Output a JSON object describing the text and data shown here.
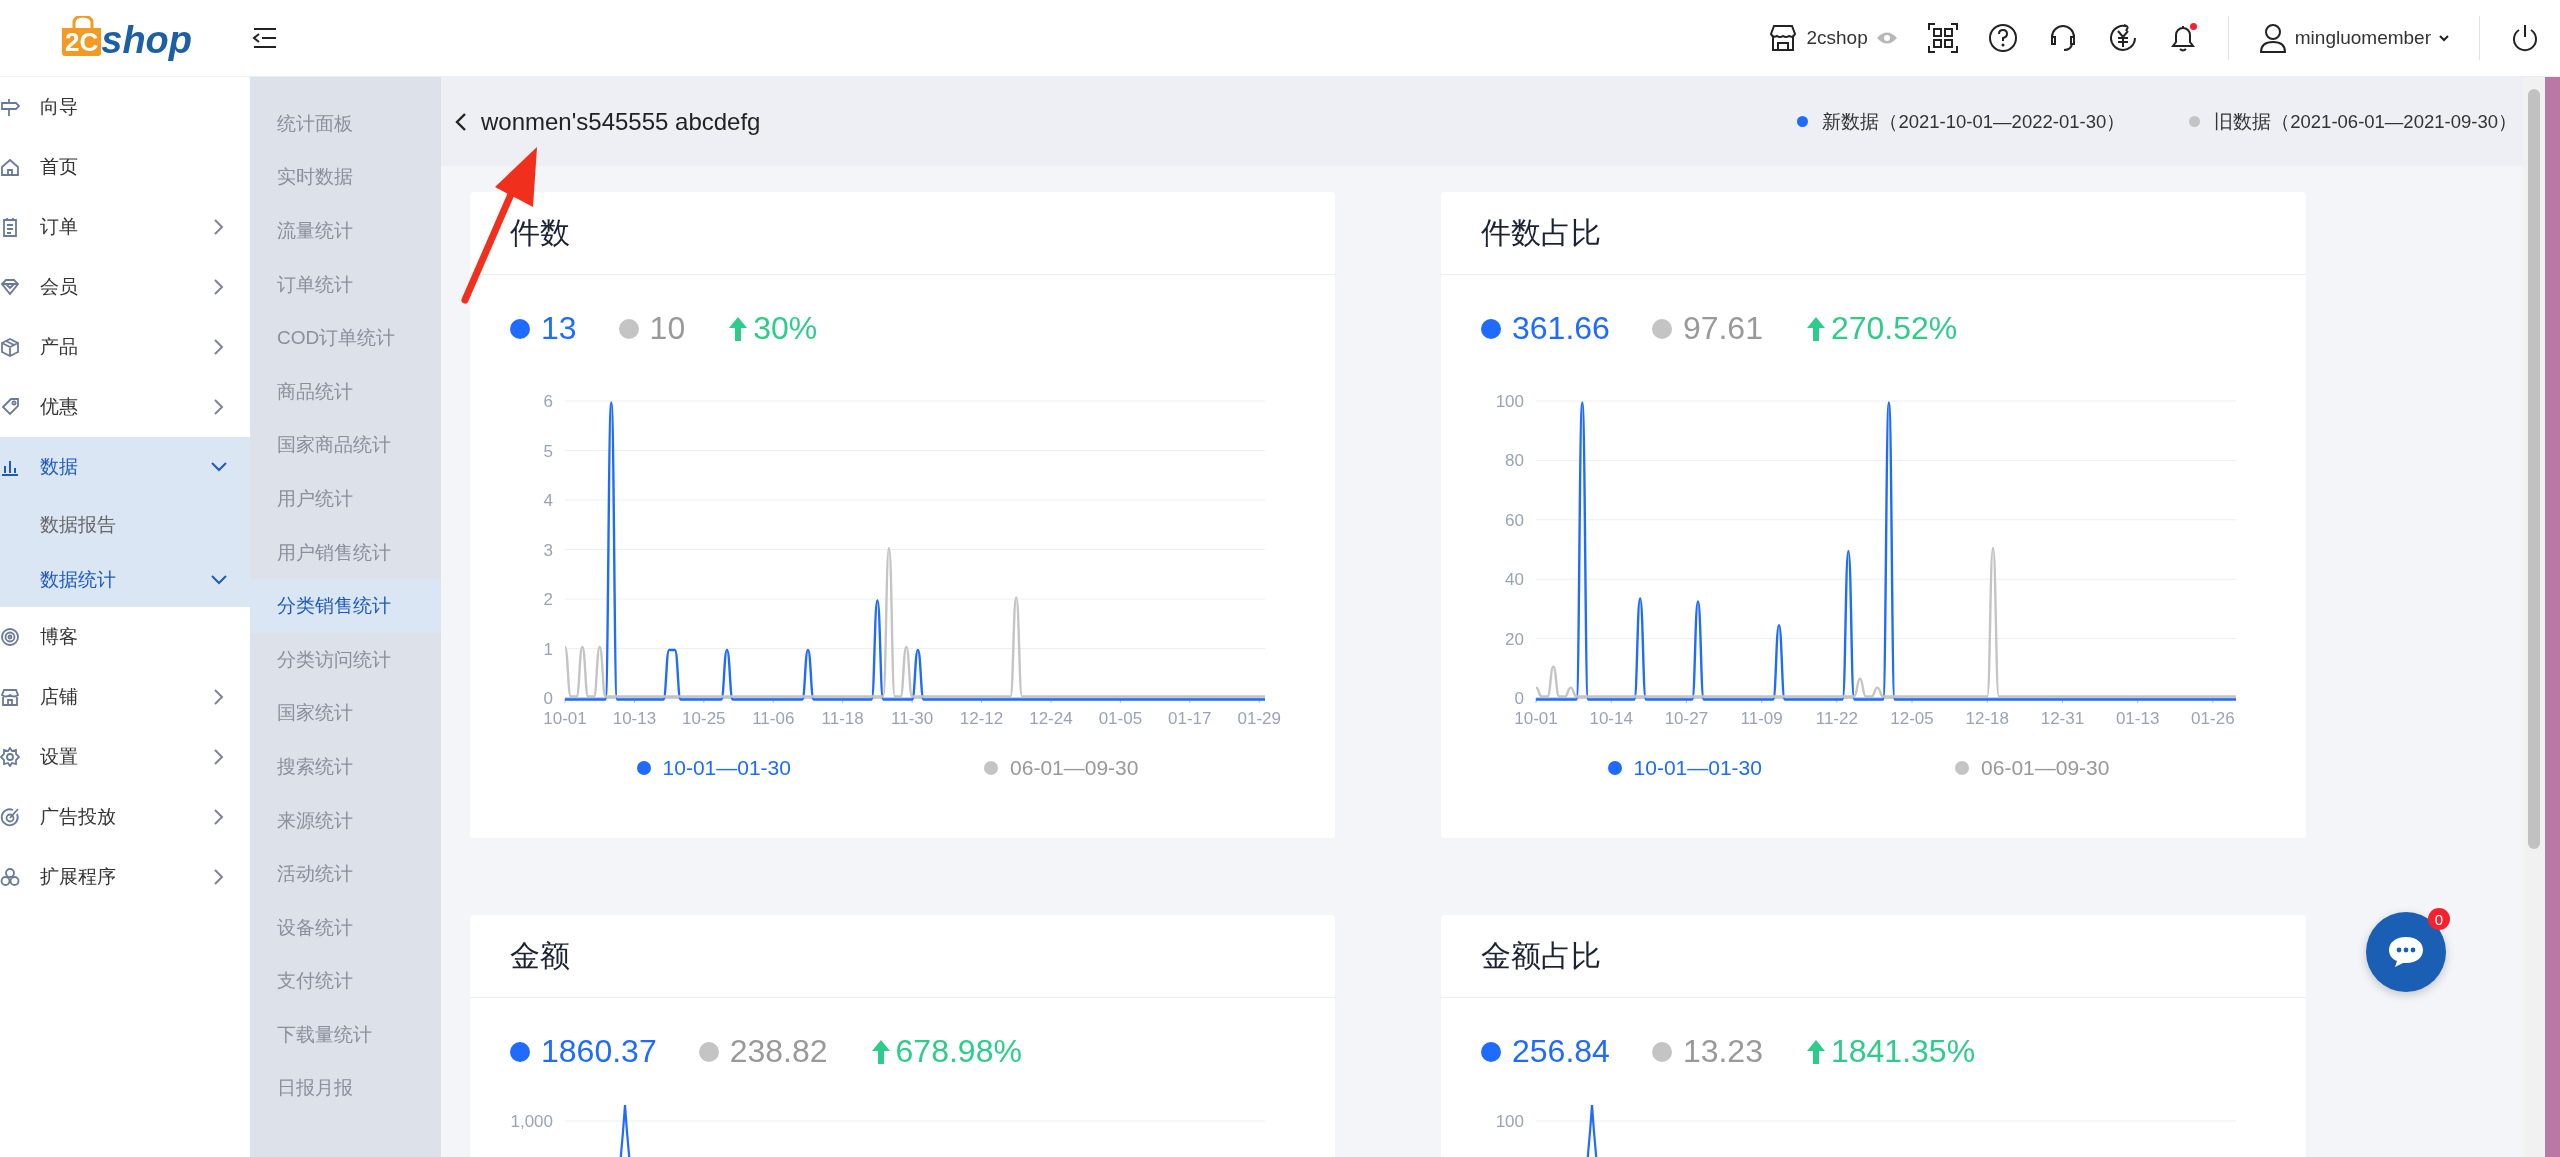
{
  "topbar": {
    "logo": {
      "mark": "2C",
      "word": "shop"
    },
    "store_name": "2cshop",
    "notifications_unread": true,
    "username": "mingluomember"
  },
  "sidebar": {
    "items": [
      {
        "label": "向导",
        "kind": "link",
        "selected": false
      },
      {
        "label": "首页",
        "kind": "link",
        "selected": false
      },
      {
        "label": "订单",
        "kind": "group",
        "selected": false,
        "expanded": false
      },
      {
        "label": "会员",
        "kind": "group",
        "selected": false,
        "expanded": false
      },
      {
        "label": "产品",
        "kind": "group",
        "selected": false,
        "expanded": false
      },
      {
        "label": "优惠",
        "kind": "group",
        "selected": false,
        "expanded": false
      },
      {
        "label": "数据",
        "kind": "group",
        "selected": true,
        "expanded": true,
        "children": [
          {
            "label": "数据报告",
            "kind": "link",
            "selected": false
          },
          {
            "label": "数据统计",
            "kind": "group",
            "selected": true,
            "expanded": true
          }
        ]
      },
      {
        "label": "博客",
        "kind": "link",
        "selected": false
      },
      {
        "label": "店铺",
        "kind": "group",
        "selected": false,
        "expanded": false
      },
      {
        "label": "设置",
        "kind": "group",
        "selected": false,
        "expanded": false
      },
      {
        "label": "广告投放",
        "kind": "group",
        "selected": false,
        "expanded": false
      },
      {
        "label": "扩展程序",
        "kind": "group",
        "selected": false,
        "expanded": false
      }
    ]
  },
  "subnav": {
    "items": [
      {
        "label": "统计面板",
        "selected": false
      },
      {
        "label": "实时数据",
        "selected": false
      },
      {
        "label": "流量统计",
        "selected": false
      },
      {
        "label": "订单统计",
        "selected": false
      },
      {
        "label": "COD订单统计",
        "selected": false
      },
      {
        "label": "商品统计",
        "selected": false
      },
      {
        "label": "国家商品统计",
        "selected": false
      },
      {
        "label": "用户统计",
        "selected": false
      },
      {
        "label": "用户销售统计",
        "selected": false
      },
      {
        "label": "分类销售统计",
        "selected": true
      },
      {
        "label": "分类访问统计",
        "selected": false
      },
      {
        "label": "国家统计",
        "selected": false
      },
      {
        "label": "搜索统计",
        "selected": false
      },
      {
        "label": "来源统计",
        "selected": false
      },
      {
        "label": "活动统计",
        "selected": false
      },
      {
        "label": "设备统计",
        "selected": false
      },
      {
        "label": "支付统计",
        "selected": false
      },
      {
        "label": "下载量统计",
        "selected": false
      },
      {
        "label": "日报月报",
        "selected": false
      }
    ]
  },
  "page": {
    "title": "wonmen's545555 abcdefg",
    "legend": [
      {
        "label": "新数据（2021-10-01—2022-01-30）",
        "color": "#1f6bff"
      },
      {
        "label": "旧数据（2021-06-01—2021-09-30）",
        "color": "#c4c4c4"
      }
    ]
  },
  "cards": [
    {
      "title": "件数",
      "current": "13",
      "previous": "10",
      "rising": true,
      "change": "30%",
      "chart_data": {
        "type": "line",
        "grid": true,
        "ylim": [
          0,
          6
        ],
        "yticks": [
          {
            "value": 0,
            "label": "0"
          },
          {
            "value": 1,
            "label": "1"
          },
          {
            "value": 2,
            "label": "2"
          },
          {
            "value": 3,
            "label": "3"
          },
          {
            "value": 4,
            "label": "4"
          },
          {
            "value": 5,
            "label": "5"
          },
          {
            "value": 6,
            "label": "6"
          }
        ],
        "categories": [
          "10-01",
          null,
          null,
          null,
          null,
          null,
          null,
          null,
          null,
          null,
          null,
          null,
          "10-13",
          null,
          null,
          null,
          null,
          null,
          null,
          null,
          null,
          null,
          null,
          null,
          "10-25",
          null,
          null,
          null,
          null,
          null,
          null,
          null,
          null,
          null,
          null,
          null,
          "11-06",
          null,
          null,
          null,
          null,
          null,
          null,
          null,
          null,
          null,
          null,
          null,
          "11-18",
          null,
          null,
          null,
          null,
          null,
          null,
          null,
          null,
          null,
          null,
          null,
          "11-30",
          null,
          null,
          null,
          null,
          null,
          null,
          null,
          null,
          null,
          null,
          null,
          "12-12",
          null,
          null,
          null,
          null,
          null,
          null,
          null,
          null,
          null,
          null,
          null,
          "12-24",
          null,
          null,
          null,
          null,
          null,
          null,
          null,
          null,
          null,
          null,
          null,
          "01-05",
          null,
          null,
          null,
          null,
          null,
          null,
          null,
          null,
          null,
          null,
          null,
          "01-17",
          null,
          null,
          null,
          null,
          null,
          null,
          null,
          null,
          null,
          null,
          null,
          "01-29",
          null
        ],
        "series": [
          {
            "name": "10-01—01-30",
            "color": "#1f6bff",
            "values": [
              0,
              0,
              0,
              0,
              0,
              0,
              0,
              0,
              6,
              0,
              0,
              0,
              0,
              0,
              0,
              0,
              0,
              0,
              1,
              1,
              0,
              0,
              0,
              0,
              0,
              0,
              0,
              0,
              1,
              0,
              0,
              0,
              0,
              0,
              0,
              0,
              0,
              0,
              0,
              0,
              0,
              0,
              1,
              0,
              0,
              0,
              0,
              0,
              0,
              0,
              0,
              0,
              0,
              0,
              2,
              0,
              0,
              0,
              0,
              0,
              0,
              1,
              0,
              0,
              0,
              0,
              0,
              0,
              0,
              0,
              0,
              0,
              0,
              0,
              0,
              0,
              0,
              0,
              0,
              0,
              0,
              0,
              0,
              0,
              0,
              0,
              0,
              0,
              0,
              0,
              0,
              0,
              0,
              0,
              0,
              0,
              0,
              0,
              0,
              0,
              0,
              0,
              0,
              0,
              0,
              0,
              0,
              0,
              0,
              0,
              0,
              0,
              0,
              0,
              0,
              0,
              0,
              0,
              0,
              0,
              0,
              0
            ]
          },
          {
            "name": "06-01—09-30",
            "color": "#c4c4c4",
            "values": [
              1,
              0,
              0,
              1,
              0,
              0,
              1,
              0,
              0,
              0,
              0,
              0,
              0,
              0,
              0,
              0,
              0,
              0,
              0,
              0,
              0,
              0,
              0,
              0,
              0,
              0,
              0,
              0,
              0,
              0,
              0,
              0,
              0,
              0,
              0,
              0,
              0,
              0,
              0,
              0,
              0,
              0,
              0,
              0,
              0,
              0,
              0,
              0,
              0,
              0,
              0,
              0,
              0,
              0,
              0,
              0,
              3,
              0,
              0,
              1,
              0,
              0,
              0,
              0,
              0,
              0,
              0,
              0,
              0,
              0,
              0,
              0,
              0,
              0,
              0,
              0,
              0,
              0,
              2,
              0,
              0,
              0,
              0,
              0,
              0,
              0,
              0,
              0,
              0,
              0,
              0,
              0,
              0,
              0,
              0,
              0,
              0,
              0,
              0,
              0,
              0,
              0,
              0,
              0,
              0,
              0,
              0,
              0,
              0,
              0,
              0,
              0,
              0,
              0,
              0,
              0,
              0,
              0,
              0,
              0,
              0,
              0
            ]
          }
        ]
      }
    },
    {
      "title": "件数占比",
      "current": "361.66",
      "previous": "97.61",
      "rising": true,
      "change": "270.52%",
      "chart_data": {
        "type": "line",
        "grid": true,
        "ylim": [
          0,
          100
        ],
        "yticks": [
          {
            "value": 0,
            "label": "0"
          },
          {
            "value": 20,
            "label": "20"
          },
          {
            "value": 40,
            "label": "40"
          },
          {
            "value": 60,
            "label": "60"
          },
          {
            "value": 80,
            "label": "80"
          },
          {
            "value": 100,
            "label": "100"
          }
        ],
        "categories": [
          "10-01",
          null,
          null,
          null,
          null,
          null,
          null,
          null,
          null,
          null,
          null,
          null,
          null,
          "10-14",
          null,
          null,
          null,
          null,
          null,
          null,
          null,
          null,
          null,
          null,
          null,
          null,
          "10-27",
          null,
          null,
          null,
          null,
          null,
          null,
          null,
          null,
          null,
          null,
          null,
          null,
          "11-09",
          null,
          null,
          null,
          null,
          null,
          null,
          null,
          null,
          null,
          null,
          null,
          null,
          "11-22",
          null,
          null,
          null,
          null,
          null,
          null,
          null,
          null,
          null,
          null,
          null,
          null,
          "12-05",
          null,
          null,
          null,
          null,
          null,
          null,
          null,
          null,
          null,
          null,
          null,
          null,
          "12-18",
          null,
          null,
          null,
          null,
          null,
          null,
          null,
          null,
          null,
          null,
          null,
          null,
          "12-31",
          null,
          null,
          null,
          null,
          null,
          null,
          null,
          null,
          null,
          null,
          null,
          null,
          "01-13",
          null,
          null,
          null,
          null,
          null,
          null,
          null,
          null,
          null,
          null,
          null,
          null,
          "01-26",
          null,
          null,
          null,
          null
        ],
        "series": [
          {
            "name": "10-01—01-30",
            "color": "#1f6bff",
            "values": [
              0,
              0,
              0,
              0,
              0,
              0,
              0,
              0,
              100,
              0,
              0,
              0,
              0,
              0,
              0,
              0,
              0,
              0,
              34,
              0,
              0,
              0,
              0,
              0,
              0,
              0,
              0,
              0,
              33,
              0,
              0,
              0,
              0,
              0,
              0,
              0,
              0,
              0,
              0,
              0,
              0,
              0,
              25,
              0,
              0,
              0,
              0,
              0,
              0,
              0,
              0,
              0,
              0,
              0,
              50,
              0,
              0,
              0,
              0,
              0,
              0,
              100,
              0,
              0,
              0,
              0,
              0,
              0,
              0,
              0,
              0,
              0,
              0,
              0,
              0,
              0,
              0,
              0,
              0,
              0,
              0,
              0,
              0,
              0,
              0,
              0,
              0,
              0,
              0,
              0,
              0,
              0,
              0,
              0,
              0,
              0,
              0,
              0,
              0,
              0,
              0,
              0,
              0,
              0,
              0,
              0,
              0,
              0,
              0,
              0,
              0,
              0,
              0,
              0,
              0,
              0,
              0,
              0,
              0,
              0,
              0,
              0
            ]
          },
          {
            "name": "06-01—09-30",
            "color": "#c4c4c4",
            "values": [
              3,
              0,
              0,
              10,
              0,
              0,
              3,
              0,
              0,
              0,
              0,
              0,
              0,
              0,
              0,
              0,
              0,
              0,
              0,
              0,
              0,
              0,
              0,
              0,
              0,
              0,
              0,
              0,
              0,
              0,
              0,
              0,
              0,
              0,
              0,
              0,
              0,
              0,
              0,
              0,
              0,
              0,
              0,
              0,
              0,
              0,
              0,
              0,
              0,
              0,
              0,
              0,
              0,
              0,
              0,
              0,
              6,
              0,
              0,
              3,
              0,
              0,
              0,
              0,
              0,
              0,
              0,
              0,
              0,
              0,
              0,
              0,
              0,
              0,
              0,
              0,
              0,
              0,
              0,
              50,
              0,
              0,
              0,
              0,
              0,
              0,
              0,
              0,
              0,
              0,
              0,
              0,
              0,
              0,
              0,
              0,
              0,
              0,
              0,
              0,
              0,
              0,
              0,
              0,
              0,
              0,
              0,
              0,
              0,
              0,
              0,
              0,
              0,
              0,
              0,
              0,
              0,
              0,
              0,
              0,
              0,
              0
            ]
          }
        ]
      }
    },
    {
      "title": "金额",
      "current": "1860.37",
      "previous": "238.82",
      "rising": true,
      "change": "678.98%",
      "top_tick": "1,000"
    },
    {
      "title": "金额占比",
      "current": "256.84",
      "previous": "13.23",
      "rising": true,
      "change": "1841.35%",
      "top_tick": "100"
    }
  ],
  "chat": {
    "badge": "0"
  }
}
